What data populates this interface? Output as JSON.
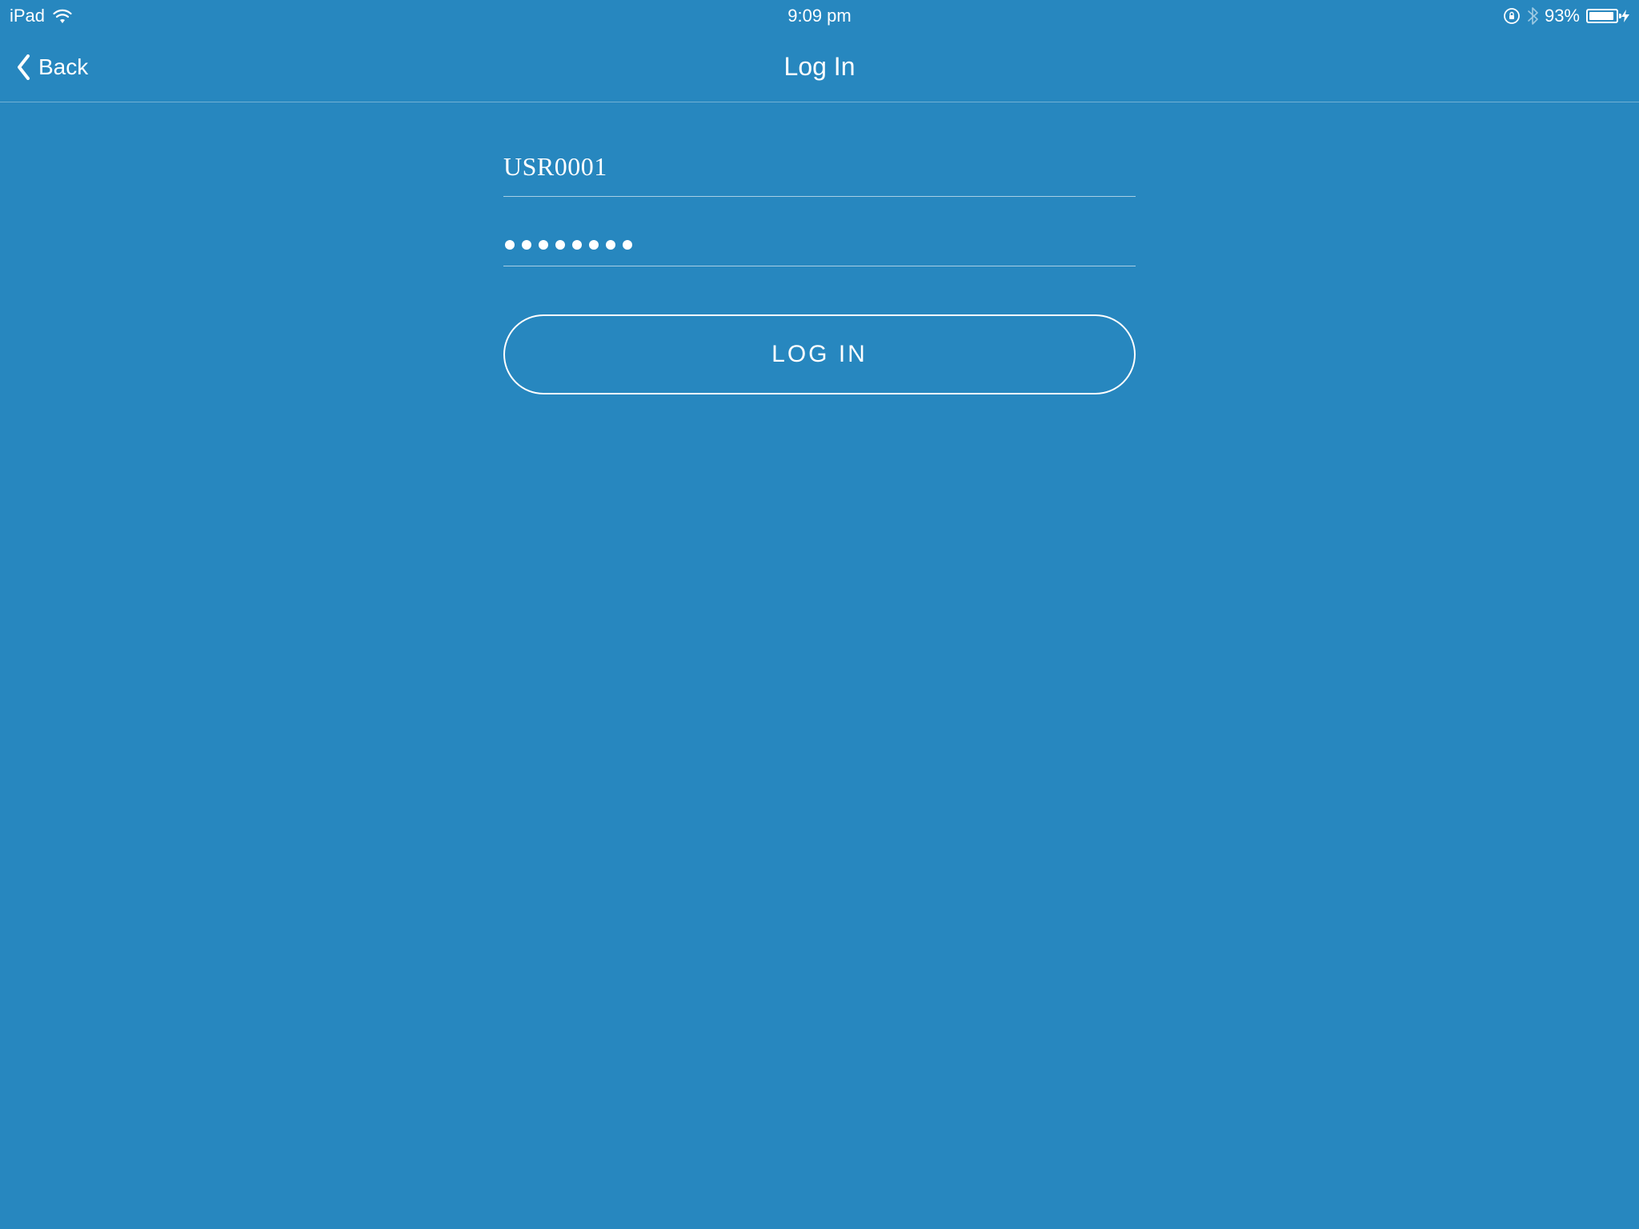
{
  "status_bar": {
    "device": "iPad",
    "time": "9:09 pm",
    "battery_percent": "93%"
  },
  "nav": {
    "back_label": "Back",
    "title": "Log In"
  },
  "form": {
    "username_value": "USR0001",
    "password_dot_count": 8,
    "login_button_label": "LOG IN"
  },
  "colors": {
    "background": "#2787bf",
    "foreground": "#ffffff"
  }
}
